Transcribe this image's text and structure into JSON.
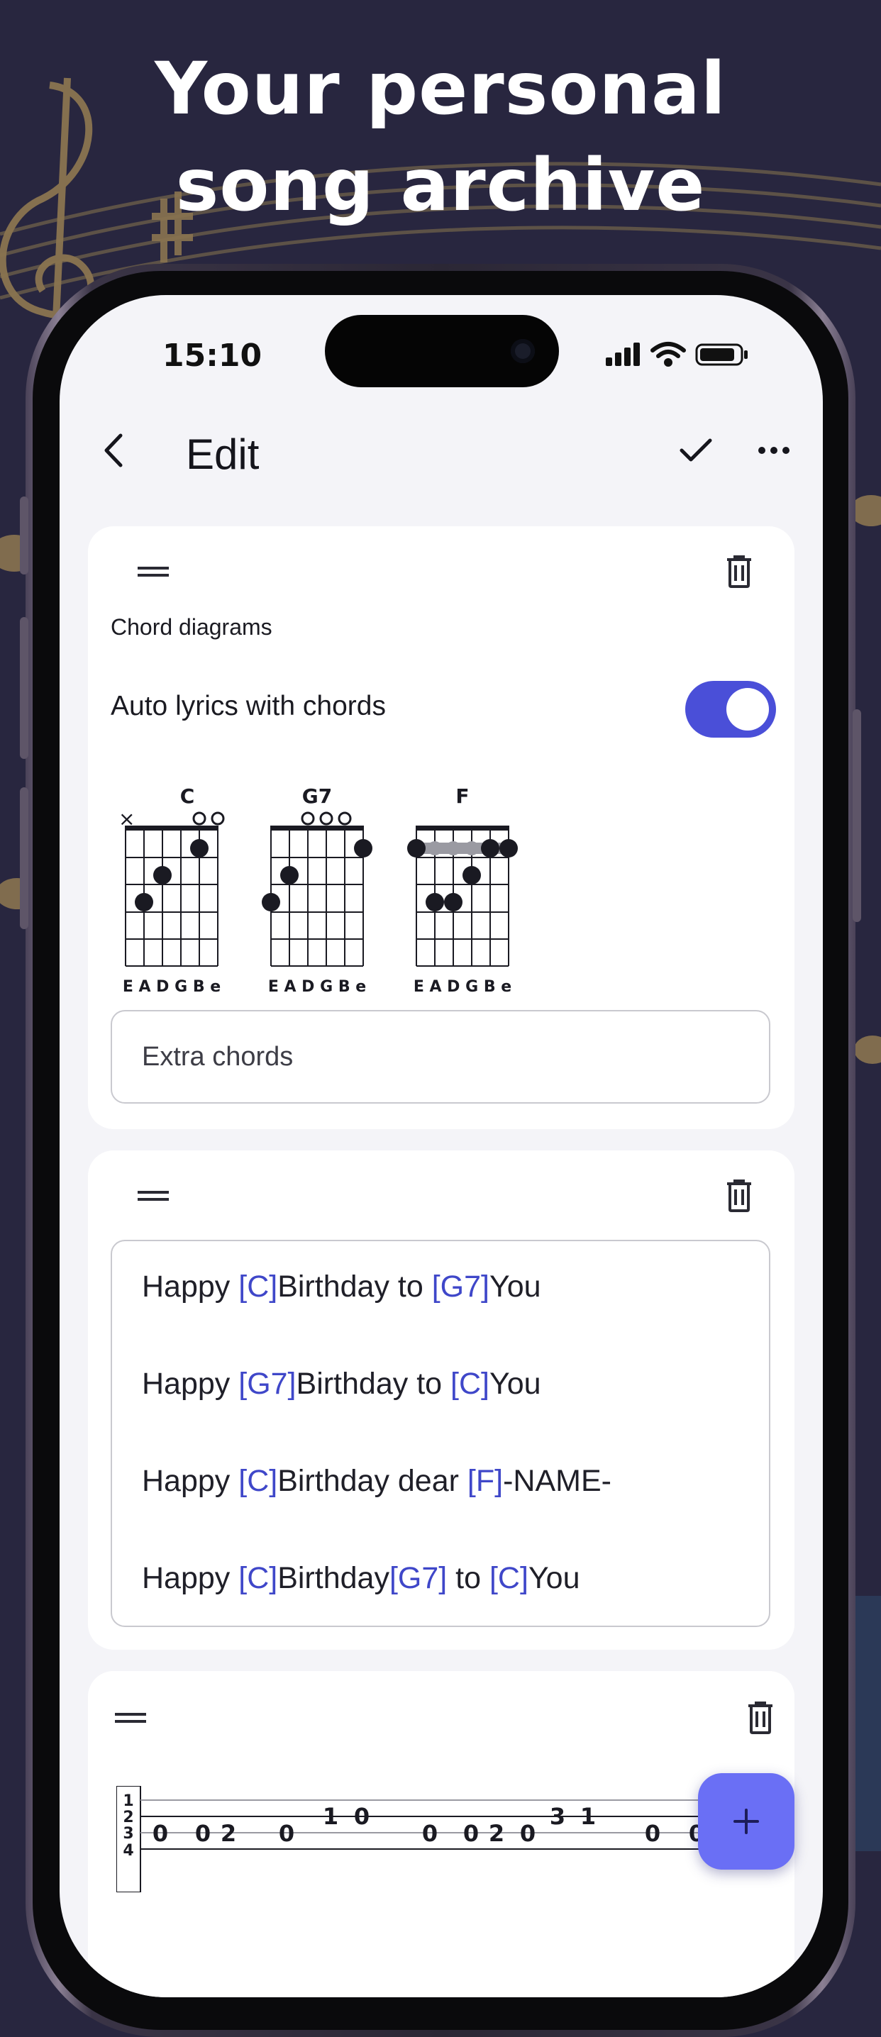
{
  "headline": {
    "line1": "Your personal",
    "line2": "song archive"
  },
  "status_bar": {
    "time": "15:10"
  },
  "header": {
    "title": "Edit"
  },
  "chord_block": {
    "section_title": "Chord diagrams",
    "toggle_label": "Auto lyrics with chords",
    "toggle_on": true,
    "chords": [
      "C",
      "G7",
      "F"
    ],
    "string_labels": "E A D G B e",
    "extra_chords_placeholder": "Extra chords"
  },
  "lyrics_block": {
    "lines": [
      [
        {
          "t": "Happy "
        },
        {
          "c": "[C]"
        },
        {
          "t": "Birthday to "
        },
        {
          "c": "[G7]"
        },
        {
          "t": "You"
        }
      ],
      [
        {
          "t": "Happy "
        },
        {
          "c": "[G7]"
        },
        {
          "t": "Birthday to "
        },
        {
          "c": "[C]"
        },
        {
          "t": "You"
        }
      ],
      [
        {
          "t": "Happy "
        },
        {
          "c": "[C]"
        },
        {
          "t": "Birthday dear "
        },
        {
          "c": "[F]"
        },
        {
          "t": "-NAME-"
        }
      ],
      [
        {
          "t": "Happy "
        },
        {
          "c": "[C]"
        },
        {
          "t": "Birthday"
        },
        {
          "c": "[G7]"
        },
        {
          "t": " to "
        },
        {
          "c": "[C]"
        },
        {
          "t": "You"
        }
      ]
    ]
  },
  "tab_block": {
    "string_numbers": [
      "1",
      "2",
      "3",
      "4"
    ],
    "string2_notes": [
      "1",
      "0",
      "3",
      "1"
    ],
    "string3_notes": [
      "0",
      "0",
      "2",
      "0",
      "0",
      "0",
      "2",
      "0",
      "0",
      "0"
    ]
  },
  "colors": {
    "accent": "#4a4fd8",
    "chord_text": "#3f47c9",
    "fab": "#6a6ff5",
    "background": "#28263f"
  },
  "icons": {
    "back": "chevron-left-icon",
    "confirm": "check-icon",
    "more": "more-horizontal-icon",
    "drag": "drag-handle-icon",
    "delete": "trash-icon",
    "add": "plus-icon"
  }
}
